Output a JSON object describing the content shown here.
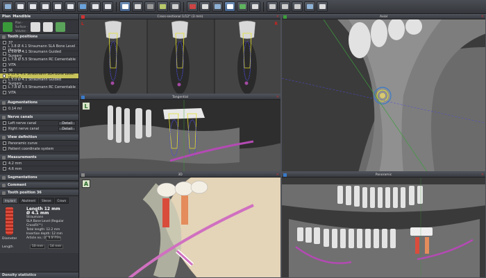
{
  "toolbar": {
    "icons": [
      "load-jaw-icon",
      "jaw-upper-icon",
      "jaw-lower-icon",
      "implant-upper-icon",
      "implant-lower-icon",
      "tooth-icon",
      "sleeve-icon",
      "bone-icon",
      "export-icon",
      "nav-icon",
      "view-icon",
      "grid-icon",
      "box-icon",
      "panel-icon",
      "drill-icon",
      "measure-icon",
      "shade-icon",
      "hand-icon",
      "axis-icon",
      "zoom-icon",
      "undo-icon",
      "camera-icon",
      "pin-icon",
      "template-icon",
      "report-icon",
      "help-icon"
    ]
  },
  "sidebar": {
    "plan_label": "Plan",
    "plan_name": "Mandible",
    "plan_sub": [
      "Plan -",
      "Surface -",
      "Volume -"
    ],
    "sections": {
      "tooth_positions": "Tooth positions",
      "augmentations": "Augmentations",
      "nerve_canals": "Nerve canals",
      "view_definition": "View definition",
      "measurements": "Measurements",
      "segmentations": "Segmentations",
      "comment": "Comment",
      "tooth_position_detail": "Tooth position 36"
    },
    "group_37": "37",
    "items_37": [
      "L 3.8 Ø 4.1 Straumann SLA Bone Level (Regula...",
      "L 5.0 Ø 4.1 Straumann Guided Surgery",
      "L 7.8 Ø 5.5 Straumann RC Cementable",
      "VITA"
    ],
    "group_36": "36",
    "items_36": [
      "L 12 Ø 4.1 Straumann SLA Bone Level (Regula...",
      "L 5.0 Ø 4.1 Straumann Guided Surgery",
      "L 7.8 Ø 5.5 Straumann RC Cementable",
      "VITA"
    ],
    "augmentation": "0.14 ml",
    "nerve_left": "Left nerve canal",
    "nerve_right": "Right nerve canal",
    "detail_btn": "Detail",
    "view_def_1": "Panoramic curve",
    "view_def_2": "Patient coordinate system",
    "meas_1": "4.2 mm",
    "meas_2": "4.6 mm",
    "tabs": [
      "Implant",
      "Abutment",
      "Sleeve",
      "Crown"
    ],
    "implant": {
      "length_line": "Length 12 mm",
      "diameter_line": "Ø 4.1 mm",
      "manufacturer": "Straumann",
      "model": "SLA Bone Level (Regular CrossFit™)",
      "total_length": "Total length: 12.2 mm",
      "insertion": "Insertion depth: 12 mm",
      "article": "Article no.: 021.4412"
    },
    "diameter_label": "Diameter",
    "diameter_value": "4.8 mm",
    "length_label": "Length",
    "length_value": "10 mm",
    "length_value2": "14 mm",
    "status": "Density statistics"
  },
  "views": {
    "cross": {
      "title": "Cross-sectional 1/12° (3 mm)",
      "labels": [
        "L",
        "R"
      ]
    },
    "axial": {
      "title": "Axial"
    },
    "tangential": {
      "title": "Tangential"
    },
    "three_d": {
      "title": "3D"
    },
    "panoramic": {
      "title": "Panoramic"
    }
  },
  "colors": {
    "accent": "#c8c35a",
    "implant": "#d94c3c",
    "nerve": "#b44ab4",
    "axis_green": "#3c9c3c",
    "title_bar": "#43464d"
  }
}
